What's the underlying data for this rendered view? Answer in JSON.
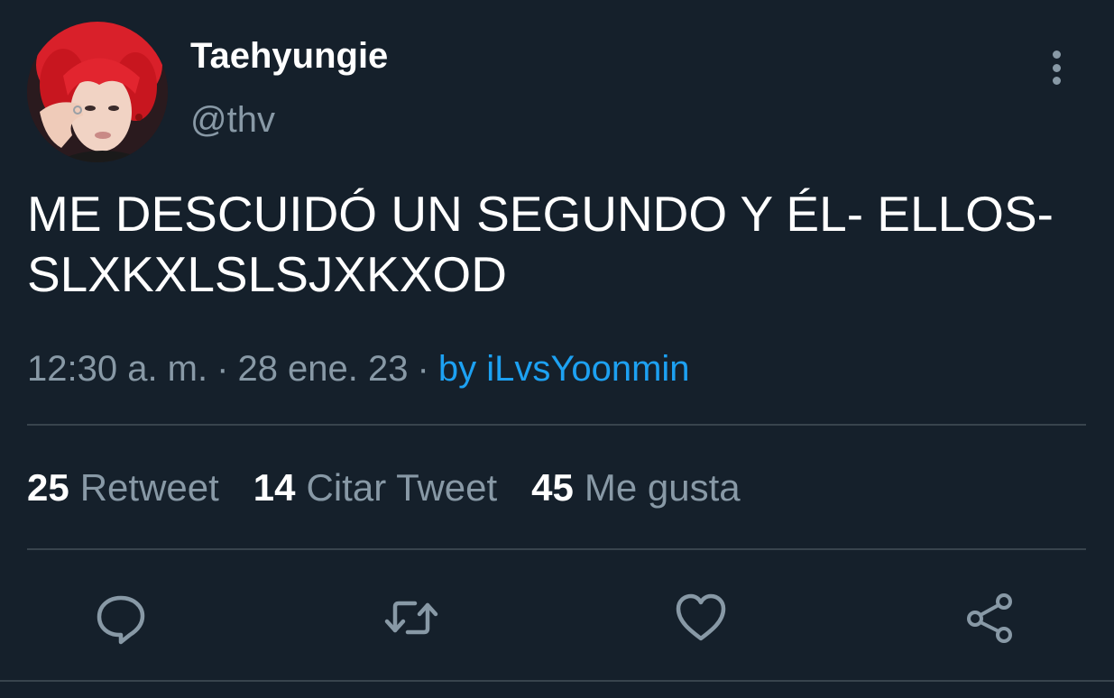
{
  "author": {
    "display_name": "Taehyungie",
    "handle": "@thv"
  },
  "tweet": {
    "text": "ME DESCUIDÓ UN SEGUNDO Y ÉL- ELLOS-\nSLXKXLSLSJXKXOD",
    "time": "12:30 a. m.",
    "separator": "·",
    "date": "28 ene. 23",
    "source": "by iLvsYoonmin"
  },
  "stats": {
    "retweets": {
      "count": "25",
      "label": "Retweet"
    },
    "quotes": {
      "count": "14",
      "label": "Citar Tweet"
    },
    "likes": {
      "count": "45",
      "label": "Me gusta"
    }
  },
  "icons": {
    "avatar": "profile-photo",
    "more": "more-vertical-icon",
    "reply": "reply-icon",
    "retweet": "retweet-icon",
    "like": "heart-icon",
    "share": "share-icon"
  },
  "colors": {
    "background": "#15202b",
    "text_primary": "#ffffff",
    "text_secondary": "#8899a6",
    "link": "#1da1f2",
    "divider": "#38444d"
  }
}
